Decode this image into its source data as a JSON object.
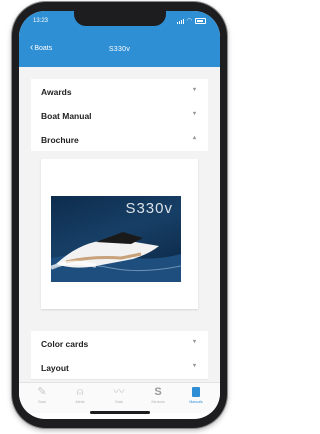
{
  "status": {
    "time": "13:23"
  },
  "nav": {
    "back_label": "Boats",
    "title": "S330v"
  },
  "sections": [
    {
      "label": "Awards",
      "expanded": false
    },
    {
      "label": "Boat Manual",
      "expanded": false
    },
    {
      "label": "Brochure",
      "expanded": true
    },
    {
      "label": "Color cards",
      "expanded": false
    },
    {
      "label": "Layout",
      "expanded": false
    }
  ],
  "brochure": {
    "image_text": "S330v"
  },
  "tabs": [
    {
      "label": "Boat",
      "icon": "pencil-icon",
      "active": false
    },
    {
      "label": "Alerts",
      "icon": "bell-icon",
      "active": false
    },
    {
      "label": "Data",
      "icon": "chart-icon",
      "active": false
    },
    {
      "label": "Services",
      "icon": "s-icon",
      "active": false
    },
    {
      "label": "Manuals",
      "icon": "book-icon",
      "active": true
    }
  ],
  "colors": {
    "accent": "#2f8fd5"
  }
}
